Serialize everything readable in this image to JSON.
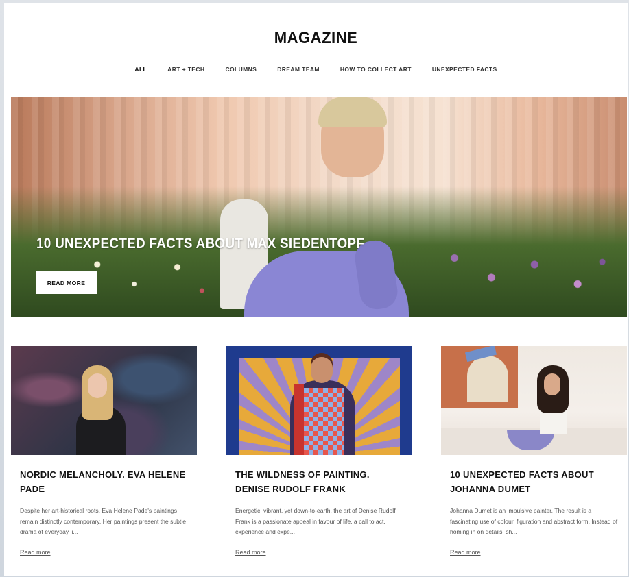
{
  "site": {
    "logo": "MAGAZINE"
  },
  "nav": {
    "items": [
      {
        "label": "ALL",
        "active": true
      },
      {
        "label": "ART + TECH"
      },
      {
        "label": "COLUMNS"
      },
      {
        "label": "DREAM TEAM"
      },
      {
        "label": "HOW TO COLLECT ART"
      },
      {
        "label": "UNEXPECTED FACTS"
      }
    ]
  },
  "hero": {
    "title": "10 UNEXPECTED FACTS ABOUT MAX SIEDENTOPF",
    "button": "READ MORE"
  },
  "articles": [
    {
      "title": "NORDIC MELANCHOLY. EVA HELENE PADE",
      "excerpt": "Despite her art-historical roots, Eva Helene Pade's paintings remain distinctly contemporary. Her paintings present the subtle drama of everyday li...",
      "link": "Read more"
    },
    {
      "title": "THE WILDNESS OF PAINTING. DENISE RUDOLF FRANK",
      "excerpt": "Energetic, vibrant, yet down-to-earth, the art of Denise Rudolf Frank is a passionate appeal in favour of life, a call to act, experience and expe...",
      "link": "Read more"
    },
    {
      "title": "10 UNEXPECTED FACTS ABOUT JOHANNA DUMET",
      "excerpt": "Johanna Dumet is an impulsive painter. The result is a fascinating use of colour, figuration and abstract form. Instead of homing in on details, sh...",
      "link": "Read more"
    }
  ]
}
